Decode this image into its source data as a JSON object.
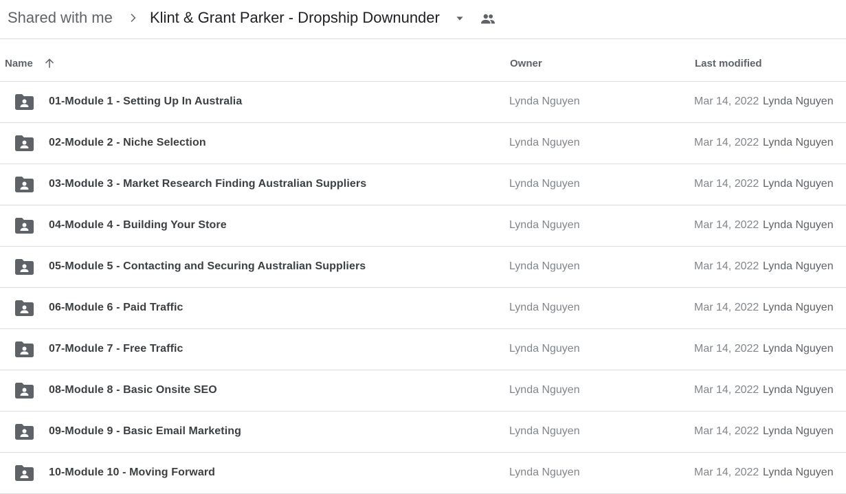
{
  "breadcrumb": {
    "root": "Shared with me",
    "current": "Klint & Grant Parker - Dropship Downunder"
  },
  "icons": {
    "separator": "chevron-right-icon",
    "dropdown": "arrow-drop-down-icon",
    "shared": "people-icon",
    "sort": "arrow-up-icon",
    "folder": "shared-folder-icon"
  },
  "columns": {
    "name": "Name",
    "owner": "Owner",
    "last_modified": "Last modified"
  },
  "colors": {
    "icon": "#5f6368",
    "divider": "#dadce0"
  },
  "files": [
    {
      "name": "01-Module 1 - Setting Up In Australia",
      "owner": "Lynda Nguyen",
      "date": "Mar 14, 2022",
      "modified_by": "Lynda Nguyen"
    },
    {
      "name": "02-Module 2 - Niche Selection",
      "owner": "Lynda Nguyen",
      "date": "Mar 14, 2022",
      "modified_by": "Lynda Nguyen"
    },
    {
      "name": "03-Module 3 - Market Research  Finding Australian Suppliers",
      "owner": "Lynda Nguyen",
      "date": "Mar 14, 2022",
      "modified_by": "Lynda Nguyen"
    },
    {
      "name": "04-Module 4 - Building Your Store",
      "owner": "Lynda Nguyen",
      "date": "Mar 14, 2022",
      "modified_by": "Lynda Nguyen"
    },
    {
      "name": "05-Module 5 - Contacting and Securing Australian Suppliers",
      "owner": "Lynda Nguyen",
      "date": "Mar 14, 2022",
      "modified_by": "Lynda Nguyen"
    },
    {
      "name": "06-Module 6 - Paid Traffic",
      "owner": "Lynda Nguyen",
      "date": "Mar 14, 2022",
      "modified_by": "Lynda Nguyen"
    },
    {
      "name": "07-Module 7 - Free Traffic",
      "owner": "Lynda Nguyen",
      "date": "Mar 14, 2022",
      "modified_by": "Lynda Nguyen"
    },
    {
      "name": "08-Module 8 - Basic Onsite SEO",
      "owner": "Lynda Nguyen",
      "date": "Mar 14, 2022",
      "modified_by": "Lynda Nguyen"
    },
    {
      "name": "09-Module 9 - Basic Email Marketing",
      "owner": "Lynda Nguyen",
      "date": "Mar 14, 2022",
      "modified_by": "Lynda Nguyen"
    },
    {
      "name": "10-Module 10 - Moving Forward",
      "owner": "Lynda Nguyen",
      "date": "Mar 14, 2022",
      "modified_by": "Lynda Nguyen"
    }
  ]
}
